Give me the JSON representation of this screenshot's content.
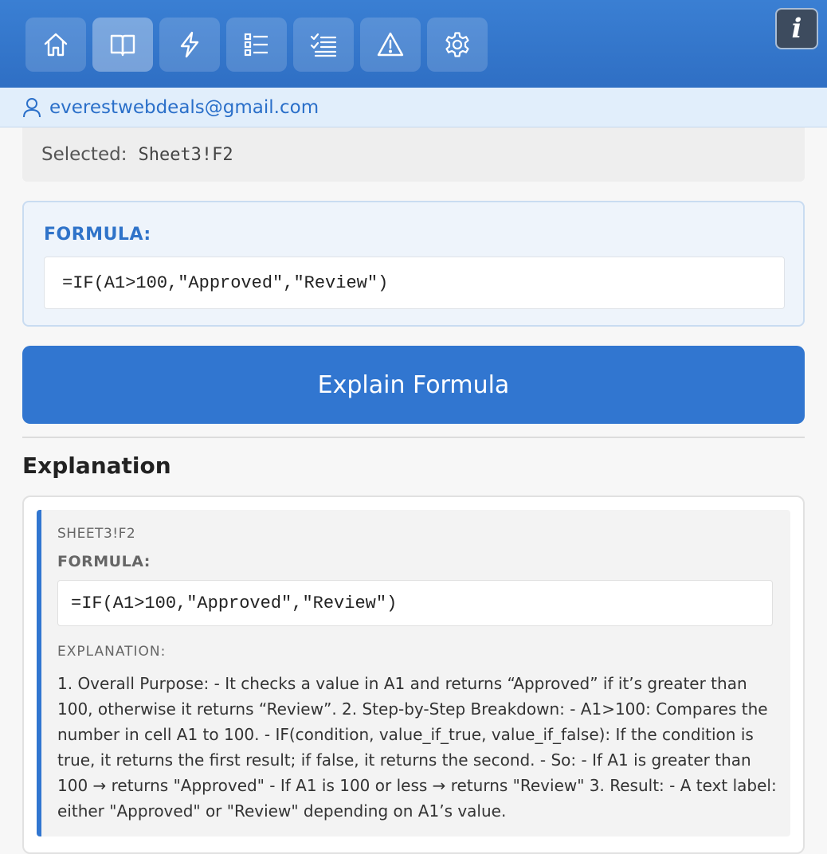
{
  "toolbar": {
    "buttons": [
      {
        "name": "home-icon",
        "active": false
      },
      {
        "name": "book-icon",
        "active": true
      },
      {
        "name": "lightning-icon",
        "active": false
      },
      {
        "name": "checklist-icon",
        "active": false
      },
      {
        "name": "tasks-icon",
        "active": false
      },
      {
        "name": "warning-icon",
        "active": false
      },
      {
        "name": "gear-icon",
        "active": false
      }
    ],
    "info_label": "i"
  },
  "user": {
    "email": "everestwebdeals@gmail.com"
  },
  "selection": {
    "label": "Selected:",
    "value": "Sheet3!F2"
  },
  "formula_panel": {
    "title": "FORMULA:",
    "formula": "=IF(A1>100,\"Approved\",\"Review\")"
  },
  "explain_button": {
    "label": "Explain Formula"
  },
  "explanation_section": {
    "heading": "Explanation"
  },
  "result": {
    "cell_ref": "SHEET3!F2",
    "formula_title": "FORMULA:",
    "formula": "=IF(A1>100,\"Approved\",\"Review\")",
    "explanation_title": "EXPLANATION:",
    "explanation_text": "1. Overall Purpose: - It checks a value in A1 and returns “Approved” if it’s greater than 100, otherwise it returns “Review”. 2. Step-by-Step Breakdown: - A1>100: Compares the number in cell A1 to 100. - IF(condition, value_if_true, value_if_false): If the condition is true, it returns the first result; if false, it returns the second. - So: - If A1 is greater than 100 → returns \"Approved\" - If A1 is 100 or less → returns \"Review\" 3. Result: - A text label: either \"Approved\" or \"Review\" depending on A1’s value."
  },
  "colors": {
    "accent": "#3176d0",
    "header": "#2f6fc4",
    "user_bar": "#e1eefb"
  }
}
